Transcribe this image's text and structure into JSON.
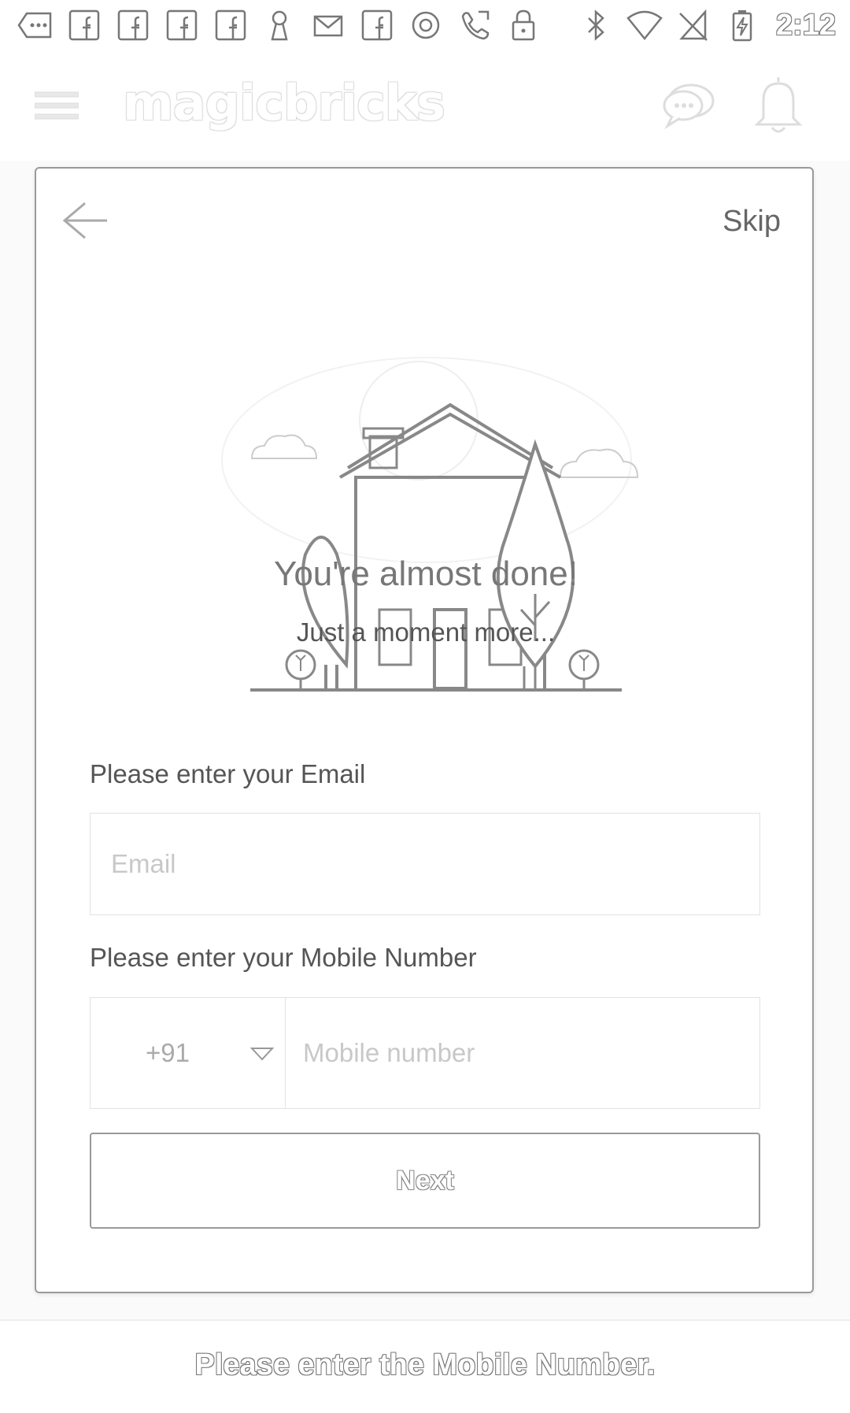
{
  "status_bar": {
    "time": "2:12",
    "left_icons": [
      "more-icon",
      "facebook-icon",
      "facebook-icon",
      "facebook-icon",
      "facebook-icon",
      "keyhole-icon",
      "mail-icon",
      "facebook-icon",
      "at-icon",
      "phone-icon",
      "lock-icon"
    ],
    "right_icons": [
      "bluetooth-icon",
      "wifi-icon",
      "no-sim-icon",
      "battery-charging-icon"
    ]
  },
  "app_bar": {
    "brand": "magicbricks",
    "icons": [
      "menu-icon",
      "chat-icon",
      "bell-icon"
    ]
  },
  "card": {
    "skip_label": "Skip",
    "title": "You're almost done!",
    "subtitle": "Just a moment more...",
    "email_label": "Please enter your Email",
    "email_placeholder": "Email",
    "email_value": "",
    "mobile_label": "Please enter your Mobile Number",
    "country_code": "+91",
    "mobile_placeholder": "Mobile number",
    "mobile_value": "",
    "next_label": "Next"
  },
  "toast": {
    "message": "Please enter the Mobile Number."
  },
  "colors": {
    "border": "#9a9a9a",
    "text": "#555555",
    "placeholder": "#c8c8c8"
  }
}
